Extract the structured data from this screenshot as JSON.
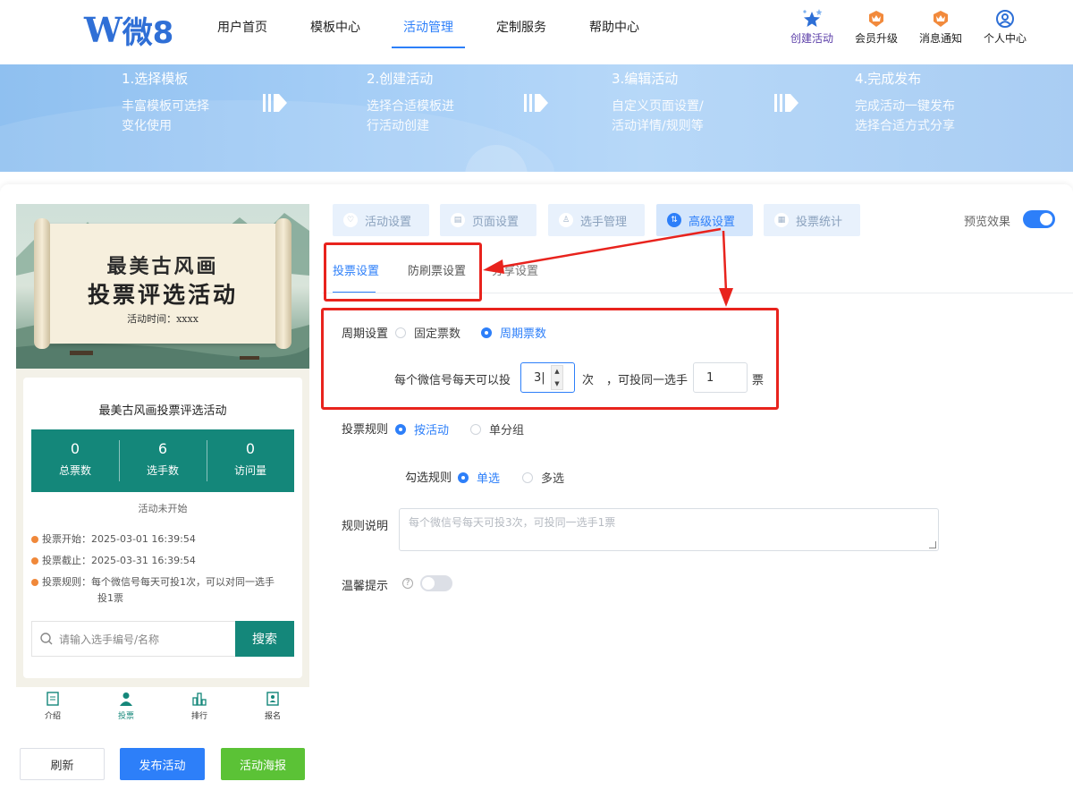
{
  "logo": {
    "mark": "W",
    "text": "微8"
  },
  "nav": [
    {
      "label": "用户首页",
      "active": false
    },
    {
      "label": "模板中心",
      "active": false
    },
    {
      "label": "活动管理",
      "active": true
    },
    {
      "label": "定制服务",
      "active": false
    },
    {
      "label": "帮助中心",
      "active": false
    }
  ],
  "header_actions": {
    "create": "创建活动",
    "upgrade": "会员升级",
    "notice": "消息通知",
    "profile": "个人中心"
  },
  "steps": [
    {
      "title": "1.选择模板",
      "desc1": "丰富模板可选择",
      "desc2": "变化使用"
    },
    {
      "title": "2.创建活动",
      "desc1": "选择合适模板进",
      "desc2": "行活动创建"
    },
    {
      "title": "3.编辑活动",
      "desc1": "自定义页面设置/",
      "desc2": "活动详情/规则等"
    },
    {
      "title": "4.完成发布",
      "desc1": "完成活动一键发布",
      "desc2": "选择合适方式分享"
    }
  ],
  "preview": {
    "poster_title1": "最美古风画",
    "poster_title2": "投票评选活动",
    "poster_time": "活动时间：xxxx",
    "card_title": "最美古风画投票评选活动",
    "stats": [
      {
        "value": "0",
        "label": "总票数"
      },
      {
        "value": "6",
        "label": "选手数"
      },
      {
        "value": "0",
        "label": "访问量"
      }
    ],
    "status": "活动未开始",
    "vote_start": "投票开始：2025-03-01 16:39:54",
    "vote_end": "投票截止：2025-03-31 16:39:54",
    "vote_rule_line1": "投票规则：每个微信号每天可投1次，可以对同一选手",
    "vote_rule_line2": "投1票",
    "search_placeholder": "请输入选手编号/名称",
    "search_button": "搜索",
    "tabbar": [
      {
        "label": "介绍",
        "active": false
      },
      {
        "label": "投票",
        "active": true
      },
      {
        "label": "排行",
        "active": false
      },
      {
        "label": "报名",
        "active": false
      }
    ]
  },
  "actions": {
    "refresh": "刷新",
    "publish": "发布活动",
    "poster": "活动海报"
  },
  "settings_tabs": [
    {
      "label": "活动设置",
      "active": false
    },
    {
      "label": "页面设置",
      "active": false
    },
    {
      "label": "选手管理",
      "active": false
    },
    {
      "label": "高级设置",
      "active": true
    },
    {
      "label": "投票统计",
      "active": false
    }
  ],
  "preview_toggle": {
    "label": "预览效果",
    "on": true
  },
  "sub_tabs": [
    {
      "label": "投票设置",
      "active": true
    },
    {
      "label": "防刷票设置",
      "active": false
    },
    {
      "label": "分享设置",
      "active": false
    }
  ],
  "form": {
    "period_label": "周期设置",
    "period_opt_fixed": "固定票数",
    "period_opt_cycle": "周期票数",
    "per_day_prefix": "每个微信号每天可以投",
    "per_day_value": "3",
    "per_day_unit": "次",
    "same_player_label": "，可投同一选手",
    "same_player_value": "1",
    "same_player_unit": "票",
    "rule_label": "投票规则",
    "rule_opt_activity": "按活动",
    "rule_opt_group": "单分组",
    "select_rule_label": "勾选规则",
    "select_opt_single": "单选",
    "select_opt_multi": "多选",
    "desc_label": "规则说明",
    "desc_placeholder": "每个微信号每天可投3次，可投同一选手1票",
    "tip_label": "温馨提示",
    "tip_on": false
  },
  "colors": {
    "primary": "#2d7ff9",
    "teal": "#14877a",
    "green": "#5bc236",
    "annotation": "#e8231d"
  }
}
